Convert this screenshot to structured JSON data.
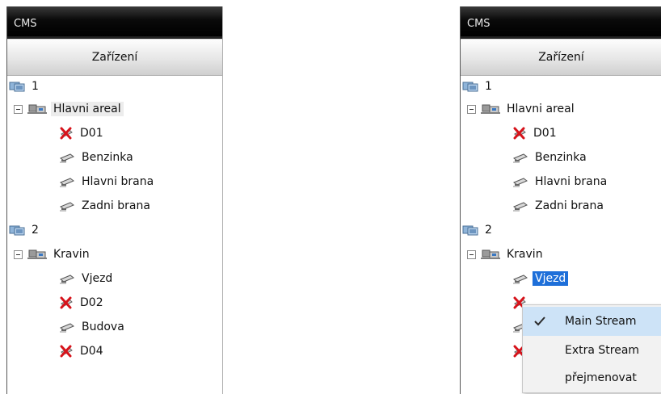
{
  "left_panel": {
    "title": "CMS",
    "tab_label": "Zařízení",
    "tree": {
      "group1": {
        "label": "1"
      },
      "area1": {
        "label": "Hlavni areal"
      },
      "area1_devices": [
        {
          "label": "D01",
          "status": "error"
        },
        {
          "label": "Benzinka",
          "status": "ok"
        },
        {
          "label": "Hlavni brana",
          "status": "ok"
        },
        {
          "label": "Zadni brana",
          "status": "ok"
        }
      ],
      "group2": {
        "label": "2"
      },
      "area2": {
        "label": "Kravin"
      },
      "area2_devices": [
        {
          "label": "Vjezd",
          "status": "ok"
        },
        {
          "label": "D02",
          "status": "error"
        },
        {
          "label": "Budova",
          "status": "ok"
        },
        {
          "label": "D04",
          "status": "error"
        }
      ]
    }
  },
  "right_panel": {
    "title": "CMS",
    "tab_label": "Zařízení",
    "tree": {
      "group1": {
        "label": "1"
      },
      "area1": {
        "label": "Hlavni areal"
      },
      "area1_devices": [
        {
          "label": "D01",
          "status": "error"
        },
        {
          "label": "Benzinka",
          "status": "ok"
        },
        {
          "label": "Hlavni brana",
          "status": "ok"
        },
        {
          "label": "Zadni brana",
          "status": "ok"
        }
      ],
      "group2": {
        "label": "2"
      },
      "area2": {
        "label": "Kravin"
      },
      "selected_device": {
        "label": "Vjezd"
      }
    }
  },
  "context_menu": {
    "items": [
      {
        "label": "Main Stream",
        "checked": true
      },
      {
        "label": "Extra Stream",
        "checked": false
      },
      {
        "label": "přejmenovat",
        "checked": false
      }
    ]
  },
  "colors": {
    "selection": "#1e6fd9",
    "error_icon": "#d6131b",
    "titlebar": "#000000"
  }
}
